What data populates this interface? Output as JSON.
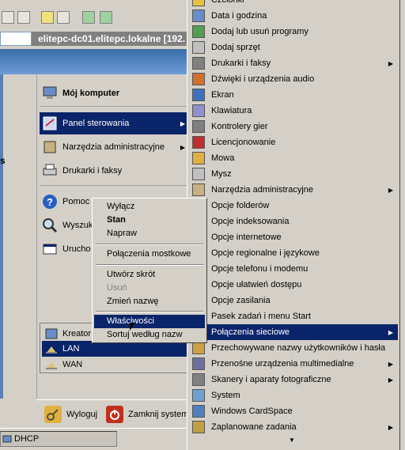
{
  "toolbar": {
    "address_value": "elitepc-dc01.elitepc.lokalne [192."
  },
  "left_panel": {
    "label": "s"
  },
  "start_menu": {
    "items": [
      {
        "label": "Mój komputer",
        "bold": true
      },
      {
        "label": "Panel sterowania",
        "selected": true
      },
      {
        "label": "Narzędzia administracyjne"
      },
      {
        "label": "Drukarki i faksy"
      },
      {
        "label": "Pomoc i"
      },
      {
        "label": "Wyszuk"
      },
      {
        "label": "Urucho"
      }
    ],
    "submenu": [
      {
        "label": "Kreator"
      },
      {
        "label": "LAN",
        "selected": true
      },
      {
        "label": "WAN"
      }
    ],
    "logoff": "Wyloguj",
    "shutdown": "Zamknij system"
  },
  "context_menu": [
    {
      "label": "Wyłącz"
    },
    {
      "label": "Stan",
      "bold": true
    },
    {
      "label": "Napraw"
    },
    {
      "label": "Połączenia mostkowe"
    },
    {
      "label": "Utwórz skrót"
    },
    {
      "label": "Usuń",
      "disabled": true
    },
    {
      "label": "Zmień nazwę"
    },
    {
      "label": "Właściwości",
      "selected": true
    },
    {
      "label": "Sortuj według nazw"
    }
  ],
  "control_panel": [
    {
      "label": "Czcionki"
    },
    {
      "label": "Data i godzina"
    },
    {
      "label": "Dodaj lub usuń programy"
    },
    {
      "label": "Dodaj sprzęt"
    },
    {
      "label": "Drukarki i faksy",
      "submenu": true
    },
    {
      "label": "Dźwięki i urządzenia audio"
    },
    {
      "label": "Ekran"
    },
    {
      "label": "Klawiatura"
    },
    {
      "label": "Kontrolery gier"
    },
    {
      "label": "Licencjonowanie"
    },
    {
      "label": "Mowa"
    },
    {
      "label": "Mysz"
    },
    {
      "label": "Narzędzia administracyjne",
      "submenu": true
    },
    {
      "label": "Opcje folderów"
    },
    {
      "label": "Opcje indeksowania"
    },
    {
      "label": "Opcje internetowe"
    },
    {
      "label": "Opcje regionalne i językowe"
    },
    {
      "label": "Opcje telefonu i modemu"
    },
    {
      "label": "Opcje ułatwień dostępu"
    },
    {
      "label": "Opcje zasilania"
    },
    {
      "label": "Pasek zadań i menu Start"
    },
    {
      "label": "Połączenia sieciowe",
      "selected": true,
      "submenu": true
    },
    {
      "label": "Przechowywane nazwy użytkowników i hasła"
    },
    {
      "label": "Przenośne urządzenia multimedialne",
      "submenu": true
    },
    {
      "label": "Skanery i aparaty fotograficzne",
      "submenu": true
    },
    {
      "label": "System"
    },
    {
      "label": "Windows CardSpace"
    },
    {
      "label": "Zaplanowane zadania",
      "submenu": true
    }
  ],
  "taskbar": {
    "dhcp_label": "DHCP"
  },
  "colors": {
    "selection": "#0a246a",
    "menu_bg": "#d4d0c8"
  }
}
